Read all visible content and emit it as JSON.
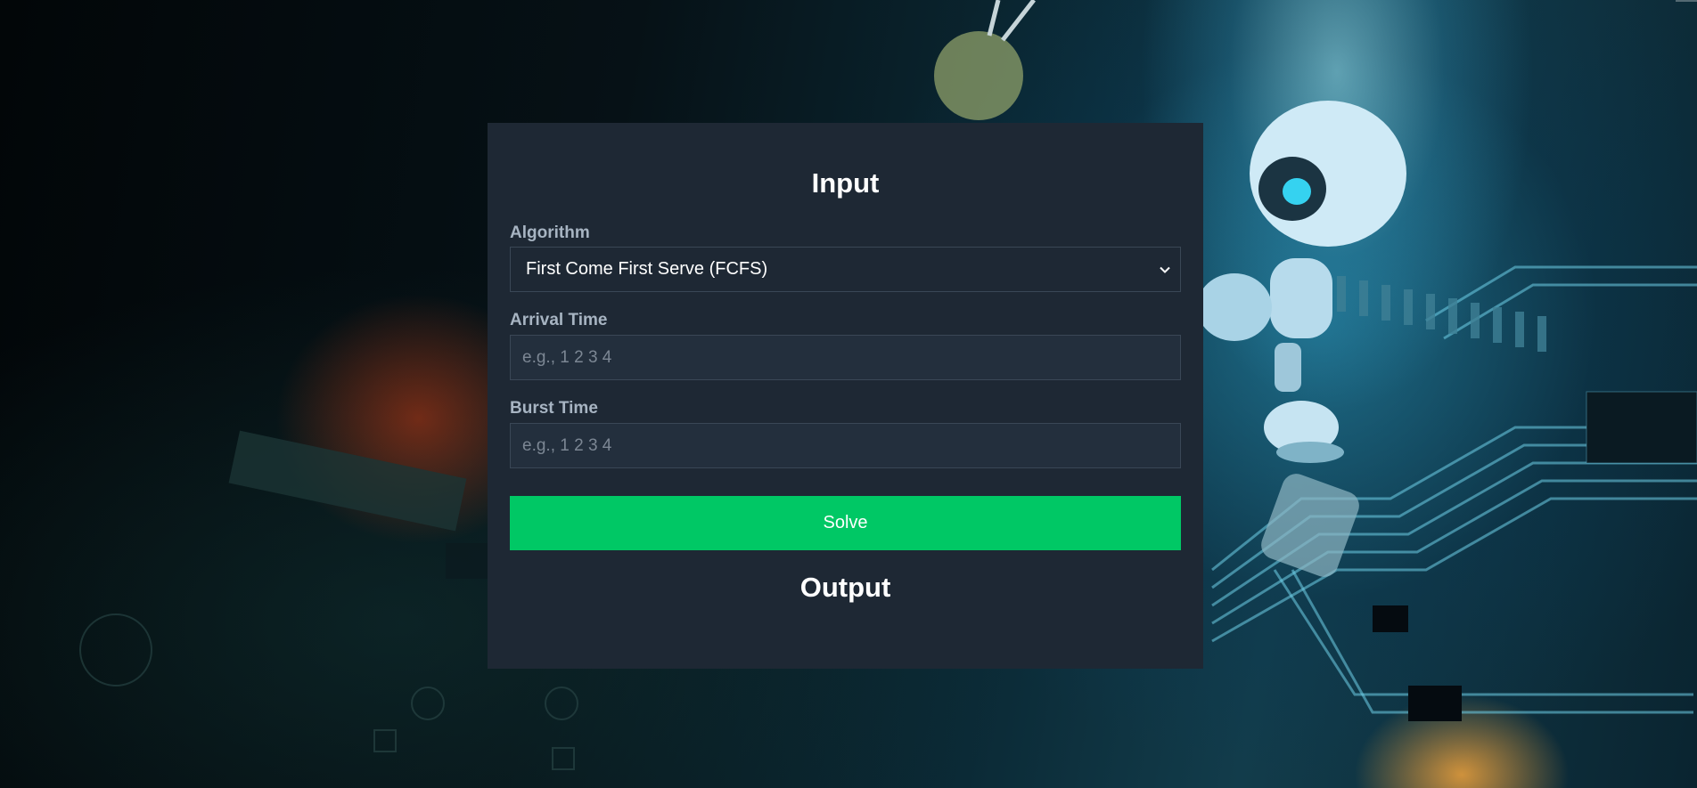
{
  "input_section": {
    "heading": "Input",
    "algorithm": {
      "label": "Algorithm",
      "selected": "First Come First Serve (FCFS)"
    },
    "arrival_time": {
      "label": "Arrival Time",
      "placeholder": "e.g., 1 2 3 4",
      "value": ""
    },
    "burst_time": {
      "label": "Burst Time",
      "placeholder": "e.g., 1 2 3 4",
      "value": ""
    },
    "solve_label": "Solve"
  },
  "output_section": {
    "heading": "Output"
  },
  "theme": {
    "panel_bg": "#1e2834",
    "accent_green": "#00c865",
    "label_color": "#a7b4c2",
    "input_border": "#3a4756"
  },
  "background": {
    "description_icon": "circuit-board-robot-image"
  }
}
